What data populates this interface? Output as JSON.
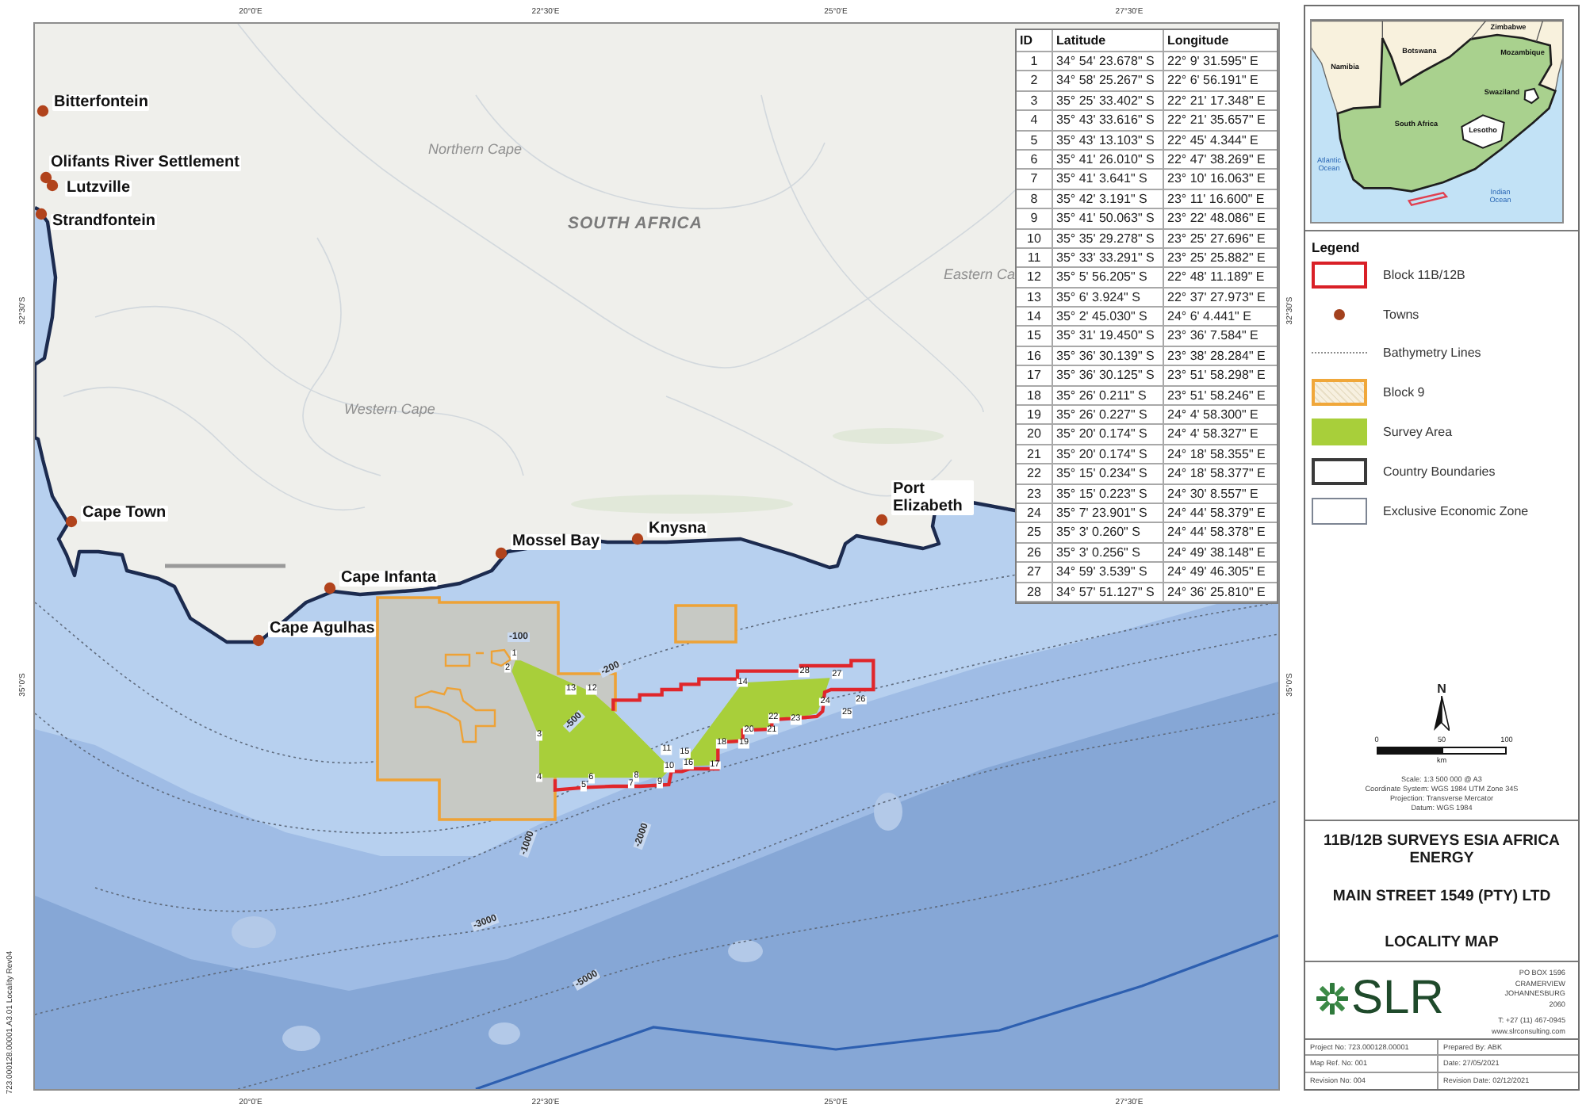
{
  "sheet": {
    "reference": "723.000128.00001.A3.01 Locality Rev04"
  },
  "graticule": {
    "top": [
      "20°0'E",
      "22°30'E",
      "25°0'E",
      "27°30'E"
    ],
    "left": [
      "32°30'S",
      "35°0'S"
    ],
    "right": [
      "32°30'S",
      "35°0'S"
    ],
    "bottom": [
      "20°0'E",
      "22°30'E",
      "25°0'E",
      "27°30'E"
    ]
  },
  "map": {
    "regions": [
      {
        "label": "Northern Cape",
        "kind": "province"
      },
      {
        "label": "SOUTH AFRICA",
        "kind": "country"
      },
      {
        "label": "Western Cape",
        "kind": "province"
      },
      {
        "label": "Eastern Ca",
        "kind": "province"
      }
    ],
    "towns": [
      "Bitterfontein",
      "Olifants River Settlement",
      "Lutzville",
      "Strandfontein",
      "Cape Town",
      "Cape Infanta",
      "Cape Agulhas",
      "Mossel Bay",
      "Knysna",
      "Port Elizabeth"
    ],
    "depth_labels": [
      "-100",
      "-200",
      "-500",
      "-1000",
      "-2000",
      "-3000",
      "-5000"
    ],
    "point_labels": [
      "1",
      "2",
      "3",
      "4",
      "5",
      "6",
      "7",
      "8",
      "9",
      "10",
      "11",
      "12",
      "13",
      "14",
      "15",
      "16",
      "17",
      "18",
      "19",
      "20",
      "21",
      "22",
      "23",
      "24",
      "25",
      "26",
      "27",
      "28"
    ]
  },
  "coordinates_table": {
    "columns": [
      "ID",
      "Latitude",
      "Longitude"
    ],
    "rows": [
      [
        "1",
        "34° 54' 23.678\" S",
        "22° 9' 31.595\" E"
      ],
      [
        "2",
        "34° 58' 25.267\" S",
        "22° 6' 56.191\" E"
      ],
      [
        "3",
        "35° 25' 33.402\" S",
        "22° 21' 17.348\" E"
      ],
      [
        "4",
        "35° 43' 33.616\" S",
        "22° 21' 35.657\" E"
      ],
      [
        "5",
        "35° 43' 13.103\" S",
        "22° 45' 4.344\" E"
      ],
      [
        "6",
        "35° 41' 26.010\" S",
        "22° 47' 38.269\" E"
      ],
      [
        "7",
        "35° 41' 3.641\" S",
        "23° 10' 16.063\" E"
      ],
      [
        "8",
        "35° 42' 3.191\" S",
        "23° 11' 16.600\" E"
      ],
      [
        "9",
        "35° 41' 50.063\" S",
        "23° 22' 48.086\" E"
      ],
      [
        "10",
        "35° 35' 29.278\" S",
        "23° 25' 27.696\" E"
      ],
      [
        "11",
        "35° 33' 33.291\" S",
        "23° 25' 25.882\" E"
      ],
      [
        "12",
        "35° 5' 56.205\" S",
        "22° 48' 11.189\" E"
      ],
      [
        "13",
        "35° 6' 3.924\" S",
        "22° 37' 27.973\" E"
      ],
      [
        "14",
        "35° 2' 45.030\" S",
        "24° 6' 4.441\" E"
      ],
      [
        "15",
        "35° 31' 19.450\" S",
        "23° 36' 7.584\" E"
      ],
      [
        "16",
        "35° 36' 30.139\" S",
        "23° 38' 28.284\" E"
      ],
      [
        "17",
        "35° 36' 30.125\" S",
        "23° 51' 58.298\" E"
      ],
      [
        "18",
        "35° 26' 0.211\" S",
        "23° 51' 58.246\" E"
      ],
      [
        "19",
        "35° 26' 0.227\" S",
        "24° 4' 58.300\" E"
      ],
      [
        "20",
        "35° 20' 0.174\" S",
        "24° 4' 58.327\" E"
      ],
      [
        "21",
        "35° 20' 0.174\" S",
        "24° 18' 58.355\" E"
      ],
      [
        "22",
        "35° 15' 0.234\" S",
        "24° 18' 58.377\" E"
      ],
      [
        "23",
        "35° 15' 0.223\" S",
        "24° 30' 8.557\" E"
      ],
      [
        "24",
        "35° 7' 23.901\" S",
        "24° 44' 58.379\" E"
      ],
      [
        "25",
        "35° 3' 0.260\" S",
        "24° 44' 58.378\" E"
      ],
      [
        "26",
        "35° 3' 0.256\" S",
        "24° 49' 38.148\" E"
      ],
      [
        "27",
        "34° 59' 3.539\" S",
        "24° 49' 46.305\" E"
      ],
      [
        "28",
        "34° 57' 51.127\" S",
        "24° 36' 25.810\" E"
      ]
    ]
  },
  "inset_map": {
    "labels": [
      {
        "text": "Zimbabwe",
        "kind": "country"
      },
      {
        "text": "Botswana",
        "kind": "country"
      },
      {
        "text": "Mozambique",
        "kind": "country"
      },
      {
        "text": "Namibia",
        "kind": "country"
      },
      {
        "text": "Swaziland",
        "kind": "country"
      },
      {
        "text": "South Africa",
        "kind": "country"
      },
      {
        "text": "Lesotho",
        "kind": "country"
      },
      {
        "text": "Atlantic Ocean",
        "kind": "ocean"
      },
      {
        "text": "Indian Ocean",
        "kind": "ocean"
      }
    ]
  },
  "legend": {
    "title": "Legend",
    "items": [
      {
        "label": "Block 11B/12B",
        "kind": "outline",
        "color": "#d92027"
      },
      {
        "label": "Towns",
        "kind": "dot",
        "color": "#a3411e"
      },
      {
        "label": "Bathymetry Lines",
        "kind": "dotted_line",
        "color": "#8c8c8c"
      },
      {
        "label": "Block 9",
        "kind": "hatched_outline",
        "color": "#f0a73a"
      },
      {
        "label": "Survey Area",
        "kind": "fill",
        "color": "#a8cf3a"
      },
      {
        "label": "Country Boundaries",
        "kind": "outline",
        "color": "#3a3a3a"
      },
      {
        "label": "Exclusive Economic Zone",
        "kind": "thin_outline",
        "color": "#7d8593"
      }
    ]
  },
  "north_arrow": {
    "label": "N"
  },
  "scale_bar": {
    "ticks": [
      "0",
      "50",
      "100"
    ],
    "unit": "km"
  },
  "map_info": [
    "Scale: 1:3 500 000 @ A3",
    "Coordinate System: WGS 1984 UTM Zone 34S",
    "Projection: Transverse Mercator",
    "Datum: WGS 1984"
  ],
  "title_block": {
    "project": "11B/12B SURVEYS ESIA AFRICA ENERGY",
    "client": "MAIN STREET 1549 (PTY) LTD",
    "title": "LOCALITY MAP"
  },
  "company": {
    "logo": "SLR",
    "address": [
      "PO BOX 1596",
      "CRAMERVIEW",
      "JOHANNESBURG",
      "2060"
    ],
    "phone": "T: +27 (11) 467-0945",
    "website": "www.slrconsulting.com"
  },
  "fields": [
    "Project No: 723.000128.00001",
    "Prepared By: ABK",
    "Map Ref. No: 001",
    "Date: 27/05/2021",
    "Revision No: 004",
    "Revision Date: 02/12/2021"
  ]
}
